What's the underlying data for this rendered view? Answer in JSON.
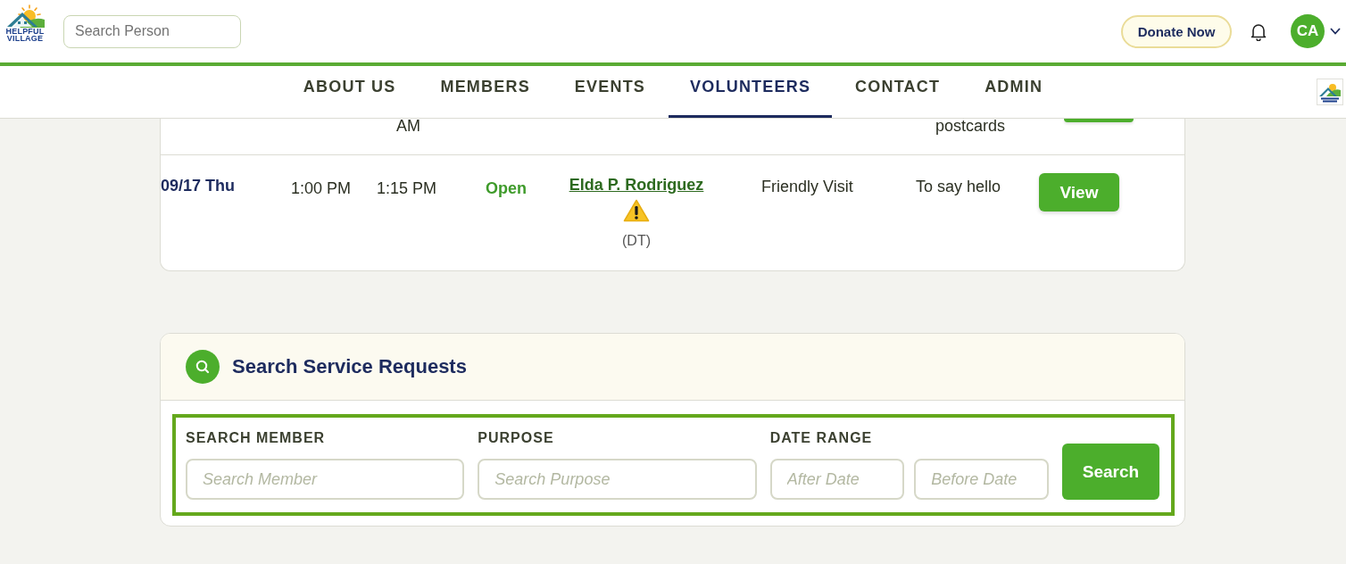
{
  "header": {
    "logo_text": [
      "HELPFUL",
      "VILLAGE"
    ],
    "search": {
      "placeholder": "Search Person"
    },
    "donate_button": "Donate Now",
    "avatar": {
      "initials": "CA"
    }
  },
  "nav": {
    "items": [
      {
        "label": "ABOUT US",
        "selected": false
      },
      {
        "label": "MEMBERS",
        "selected": false
      },
      {
        "label": "EVENTS",
        "selected": false
      },
      {
        "label": "VOLUNTEERS",
        "selected": true
      },
      {
        "label": "CONTACT",
        "selected": false
      },
      {
        "label": "ADMIN",
        "selected": false
      }
    ]
  },
  "requests": {
    "partial_row": {
      "end_time": "AM",
      "purpose": "postcards"
    },
    "rows": [
      {
        "date": "09/17 Thu",
        "start_time": "1:00 PM",
        "end_time": "1:15 PM",
        "status": "Open",
        "member": "Elda P. Rodriguez",
        "warning": true,
        "member_note": "(DT)",
        "type": "Friendly Visit",
        "purpose": "To say hello",
        "action": "View"
      }
    ]
  },
  "search_panel": {
    "title": "Search Service Requests",
    "fields": [
      {
        "label": "SEARCH MEMBER",
        "inputs": [
          {
            "placeholder": "Search Member"
          }
        ]
      },
      {
        "label": "PURPOSE",
        "inputs": [
          {
            "placeholder": "Search Purpose"
          }
        ]
      },
      {
        "label": "DATE RANGE",
        "inputs": [
          {
            "placeholder": "After Date"
          },
          {
            "placeholder": "Before Date"
          }
        ]
      }
    ],
    "button": "Search"
  }
}
